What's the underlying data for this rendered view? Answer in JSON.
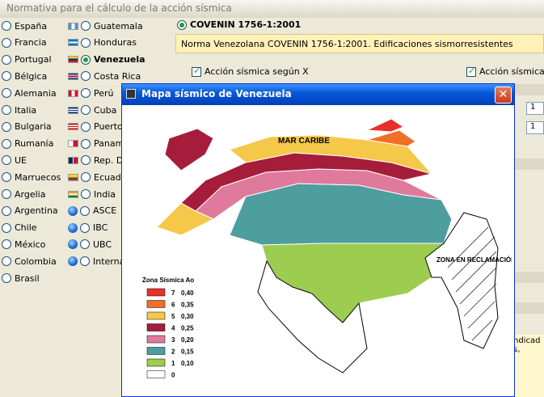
{
  "window": {
    "title": "Normativa para el cálculo de la acción sísmica"
  },
  "countries_left": [
    {
      "label": "España",
      "selected": false
    },
    {
      "label": "Francia",
      "selected": false
    },
    {
      "label": "Portugal",
      "selected": false
    },
    {
      "label": "Bélgica",
      "selected": false
    },
    {
      "label": "Alemania",
      "selected": false
    },
    {
      "label": "Italia",
      "selected": false
    },
    {
      "label": "Bulgaria",
      "selected": false
    },
    {
      "label": "Rumanía",
      "selected": false
    },
    {
      "label": "UE",
      "selected": false
    },
    {
      "label": "Marruecos",
      "selected": false
    },
    {
      "label": "Argelia",
      "selected": false
    },
    {
      "label": "Argentina",
      "selected": false
    },
    {
      "label": "Chile",
      "selected": false
    },
    {
      "label": "México",
      "selected": false
    },
    {
      "label": "Colombia",
      "selected": false
    },
    {
      "label": "Brasil",
      "selected": false
    }
  ],
  "countries_right": [
    {
      "label": "Guatemala",
      "selected": false,
      "icon": "flag-guatemala-icon"
    },
    {
      "label": "Honduras",
      "selected": false,
      "icon": "flag-honduras-icon"
    },
    {
      "label": "Venezuela",
      "selected": true,
      "icon": "flag-venezuela-icon"
    },
    {
      "label": "Costa Rica",
      "selected": false,
      "icon": "flag-costa-rica-icon"
    },
    {
      "label": "Perú",
      "selected": false,
      "icon": "flag-peru-icon"
    },
    {
      "label": "Cuba",
      "selected": false,
      "icon": "flag-cuba-icon"
    },
    {
      "label": "Puerto R",
      "selected": false,
      "icon": "flag-puerto-rico-icon"
    },
    {
      "label": "Panamá",
      "selected": false,
      "icon": "flag-panama-icon"
    },
    {
      "label": "Rep. D",
      "selected": false,
      "icon": "flag-dominican-icon"
    },
    {
      "label": "Ecuador",
      "selected": false,
      "icon": "flag-ecuador-icon"
    },
    {
      "label": "India",
      "selected": false,
      "icon": "flag-india-icon"
    },
    {
      "label": "ASCE",
      "selected": false,
      "icon": "globe-icon"
    },
    {
      "label": "IBC",
      "selected": false,
      "icon": "globe-icon"
    },
    {
      "label": "UBC",
      "selected": false,
      "icon": "globe-icon"
    },
    {
      "label": "Internac",
      "selected": false,
      "icon": "globe-icon"
    }
  ],
  "norm": {
    "code": "COVENIN 1756-1:2001",
    "description": "Norma Venezolana COVENIN 1756-1:2001. Edificaciones sismorresistentes",
    "check_x": "Acción sísmica según X",
    "check_y": "Acción sísmica s",
    "field1": "1",
    "field2": "1",
    "note": "ndicad s,"
  },
  "popup": {
    "title": "Mapa sísmico de Venezuela",
    "label_sea": "MAR CARIBE",
    "label_zone": "ZONA EN RECLAMACIÓN",
    "legend_title": "Zona Sísmica Ao",
    "legend": [
      {
        "zone": "7",
        "ao": "0,40",
        "color": "#e8302a"
      },
      {
        "zone": "6",
        "ao": "0,35",
        "color": "#f07028"
      },
      {
        "zone": "5",
        "ao": "0,30",
        "color": "#f5c84a"
      },
      {
        "zone": "4",
        "ao": "0,25",
        "color": "#a51d3a"
      },
      {
        "zone": "3",
        "ao": "0,20",
        "color": "#e07a9c"
      },
      {
        "zone": "2",
        "ao": "0,15",
        "color": "#4e9ea0"
      },
      {
        "zone": "1",
        "ao": "0,10",
        "color": "#9ccc50"
      },
      {
        "zone": "0",
        "ao": "",
        "color": "#ffffff"
      }
    ]
  }
}
